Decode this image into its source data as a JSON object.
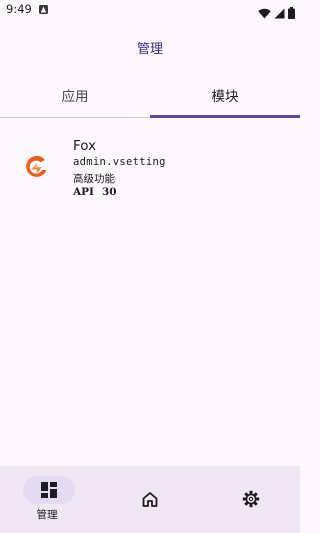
{
  "status_bar": {
    "time": "9:49"
  },
  "header": {
    "title": "管理"
  },
  "tabs": [
    {
      "label": "应用",
      "selected": false
    },
    {
      "label": "模块",
      "selected": true
    }
  ],
  "modules": [
    {
      "name": "Fox",
      "package": "admin.vsetting",
      "description": "高级功能",
      "api_label": "API",
      "api_value": "30",
      "icon": "fox-logo-icon"
    }
  ],
  "bottom_nav": {
    "items": [
      {
        "label": "管理",
        "icon": "dashboard-icon",
        "selected": true
      },
      {
        "label": "",
        "icon": "home-icon",
        "selected": false
      },
      {
        "label": "",
        "icon": "settings-gear-icon",
        "selected": false
      }
    ]
  },
  "colors": {
    "background": "#fdf7fe",
    "accent": "#5b4a9e",
    "title": "#3e2a7a",
    "nav_background": "#efe8f4",
    "nav_pill": "#e3dbf2",
    "logo_orange": "#e8601c"
  }
}
